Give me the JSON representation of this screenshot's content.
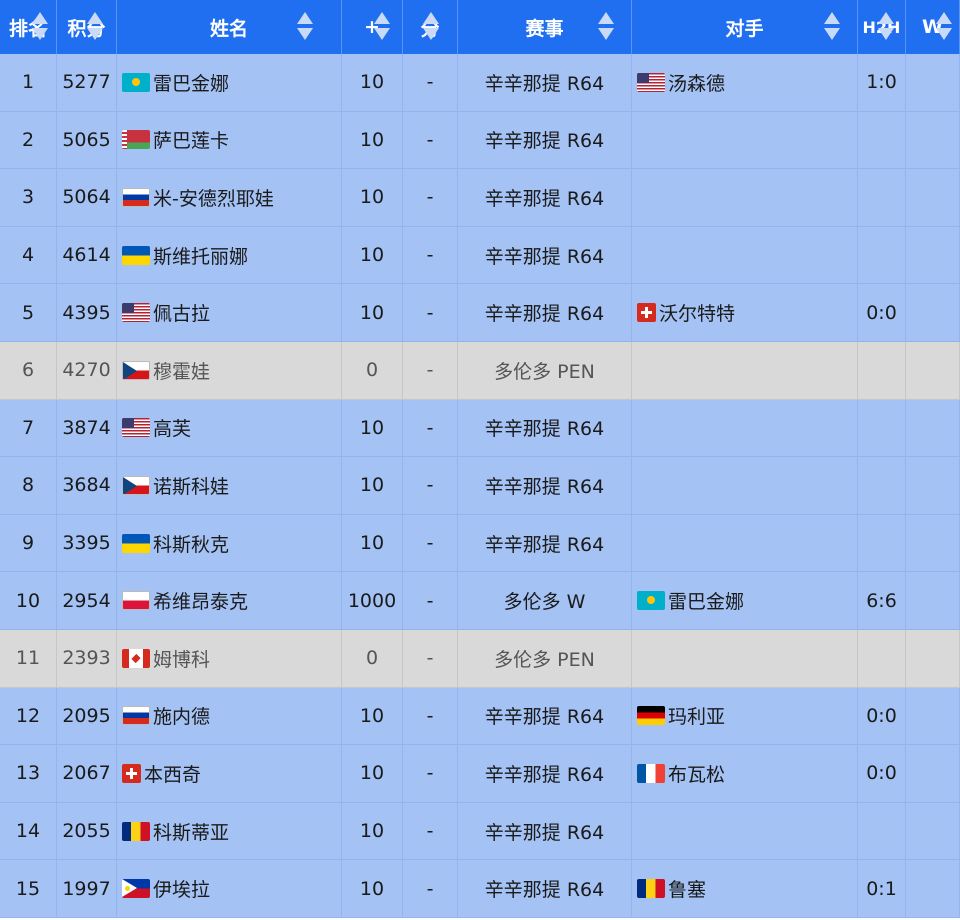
{
  "header": {
    "columns": [
      {
        "id": "rank",
        "label": "排名",
        "sortable": true
      },
      {
        "id": "points",
        "label": "积分",
        "sortable": true
      },
      {
        "id": "name",
        "label": "姓名",
        "sortable": true
      },
      {
        "id": "plus",
        "label": "+",
        "sortable": true
      },
      {
        "id": "pts",
        "label": "分",
        "sortable": true
      },
      {
        "id": "event",
        "label": "赛事",
        "sortable": true
      },
      {
        "id": "opponent",
        "label": "对手",
        "sortable": true
      },
      {
        "id": "h2h",
        "label": "H2H",
        "sortable": true
      },
      {
        "id": "w",
        "label": "W",
        "sortable": true
      }
    ]
  },
  "colors": {
    "header_bg": "#1f6ff0",
    "row_active": "#a4c2f4",
    "row_eliminated": "#d9d9d9"
  },
  "rows": [
    {
      "rank": "1",
      "points": "5277",
      "flag": "flag-kazakhstan-icon",
      "flagClass": "f-kz",
      "name": "雷巴金娜",
      "plus": "10",
      "pts": "-",
      "event": "辛辛那提 R64",
      "oppFlag": "flag-usa-icon",
      "oppFlagClass": "f-us",
      "opponent": "汤森德",
      "h2h": "1:0",
      "w": "",
      "state": "blue"
    },
    {
      "rank": "2",
      "points": "5065",
      "flag": "flag-belarus-icon",
      "flagClass": "f-by",
      "name": "萨巴莲卡",
      "plus": "10",
      "pts": "-",
      "event": "辛辛那提 R64",
      "oppFlag": "",
      "oppFlagClass": "",
      "opponent": "",
      "h2h": "",
      "w": "",
      "state": "blue"
    },
    {
      "rank": "3",
      "points": "5064",
      "flag": "flag-russia-icon",
      "flagClass": "f-ru",
      "name": "米-安德烈耶娃",
      "plus": "10",
      "pts": "-",
      "event": "辛辛那提 R64",
      "oppFlag": "",
      "oppFlagClass": "",
      "opponent": "",
      "h2h": "",
      "w": "",
      "state": "blue"
    },
    {
      "rank": "4",
      "points": "4614",
      "flag": "flag-ukraine-icon",
      "flagClass": "f-ua",
      "name": "斯维托丽娜",
      "plus": "10",
      "pts": "-",
      "event": "辛辛那提 R64",
      "oppFlag": "",
      "oppFlagClass": "",
      "opponent": "",
      "h2h": "",
      "w": "",
      "state": "blue"
    },
    {
      "rank": "5",
      "points": "4395",
      "flag": "flag-usa-icon",
      "flagClass": "f-us",
      "name": "佩古拉",
      "plus": "10",
      "pts": "-",
      "event": "辛辛那提 R64",
      "oppFlag": "flag-switzerland-icon",
      "oppFlagClass": "f-ch",
      "opponent": "沃尔特特",
      "h2h": "0:0",
      "w": "",
      "state": "blue"
    },
    {
      "rank": "6",
      "points": "4270",
      "flag": "flag-czech-icon",
      "flagClass": "f-cz",
      "name": "穆霍娃",
      "plus": "0",
      "pts": "-",
      "event": "多伦多 PEN",
      "oppFlag": "",
      "oppFlagClass": "",
      "opponent": "",
      "h2h": "",
      "w": "",
      "state": "grey"
    },
    {
      "rank": "7",
      "points": "3874",
      "flag": "flag-usa-icon",
      "flagClass": "f-us",
      "name": "高芙",
      "plus": "10",
      "pts": "-",
      "event": "辛辛那提 R64",
      "oppFlag": "",
      "oppFlagClass": "",
      "opponent": "",
      "h2h": "",
      "w": "",
      "state": "blue"
    },
    {
      "rank": "8",
      "points": "3684",
      "flag": "flag-czech-icon",
      "flagClass": "f-cz",
      "name": "诺斯科娃",
      "plus": "10",
      "pts": "-",
      "event": "辛辛那提 R64",
      "oppFlag": "",
      "oppFlagClass": "",
      "opponent": "",
      "h2h": "",
      "w": "",
      "state": "blue"
    },
    {
      "rank": "9",
      "points": "3395",
      "flag": "flag-ukraine-icon",
      "flagClass": "f-ua",
      "name": "科斯秋克",
      "plus": "10",
      "pts": "-",
      "event": "辛辛那提 R64",
      "oppFlag": "",
      "oppFlagClass": "",
      "opponent": "",
      "h2h": "",
      "w": "",
      "state": "blue"
    },
    {
      "rank": "10",
      "points": "2954",
      "flag": "flag-poland-icon",
      "flagClass": "f-pl",
      "name": "希维昂泰克",
      "plus": "1000",
      "pts": "-",
      "event": "多伦多 W",
      "oppFlag": "flag-kazakhstan-icon",
      "oppFlagClass": "f-kz",
      "opponent": "雷巴金娜",
      "h2h": "6:6",
      "w": "",
      "state": "blue"
    },
    {
      "rank": "11",
      "points": "2393",
      "flag": "flag-canada-icon",
      "flagClass": "f-ca",
      "name": "姆博科",
      "plus": "0",
      "pts": "-",
      "event": "多伦多 PEN",
      "oppFlag": "",
      "oppFlagClass": "",
      "opponent": "",
      "h2h": "",
      "w": "",
      "state": "grey"
    },
    {
      "rank": "12",
      "points": "2095",
      "flag": "flag-russia-icon",
      "flagClass": "f-ru",
      "name": "施内德",
      "plus": "10",
      "pts": "-",
      "event": "辛辛那提 R64",
      "oppFlag": "flag-germany-icon",
      "oppFlagClass": "f-de",
      "opponent": "玛利亚",
      "h2h": "0:0",
      "w": "",
      "state": "blue"
    },
    {
      "rank": "13",
      "points": "2067",
      "flag": "flag-switzerland-icon",
      "flagClass": "f-ch",
      "name": "本西奇",
      "plus": "10",
      "pts": "-",
      "event": "辛辛那提 R64",
      "oppFlag": "flag-france-icon",
      "oppFlagClass": "f-fr",
      "opponent": "布瓦松",
      "h2h": "0:0",
      "w": "",
      "state": "blue"
    },
    {
      "rank": "14",
      "points": "2055",
      "flag": "flag-romania-icon",
      "flagClass": "f-ro",
      "name": "科斯蒂亚",
      "plus": "10",
      "pts": "-",
      "event": "辛辛那提 R64",
      "oppFlag": "",
      "oppFlagClass": "",
      "opponent": "",
      "h2h": "",
      "w": "",
      "state": "blue"
    },
    {
      "rank": "15",
      "points": "1997",
      "flag": "flag-philippines-icon",
      "flagClass": "f-ph",
      "name": "伊埃拉",
      "plus": "10",
      "pts": "-",
      "event": "辛辛那提 R64",
      "oppFlag": "flag-romania-icon",
      "oppFlagClass": "f-ro",
      "opponent": "鲁塞",
      "h2h": "0:1",
      "w": "",
      "state": "blue"
    }
  ]
}
